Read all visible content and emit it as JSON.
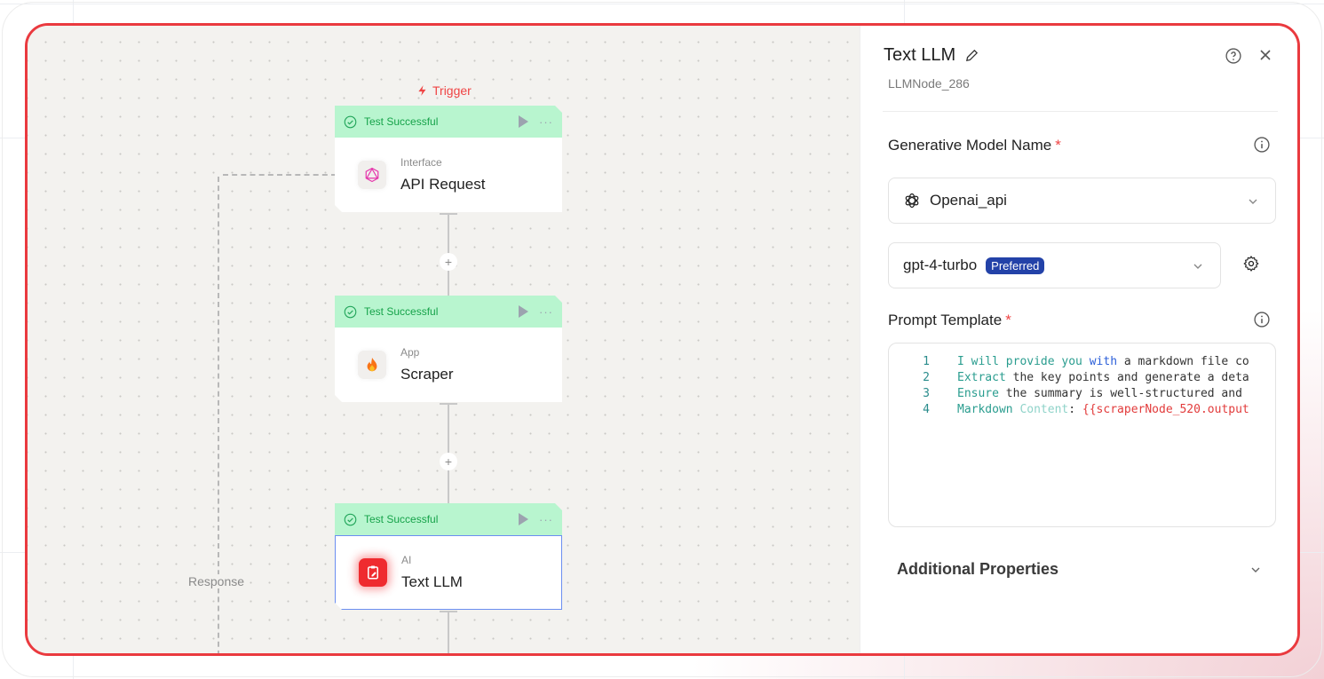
{
  "canvas": {
    "trigger_label": "Trigger",
    "response_label": "Response",
    "nodes": [
      {
        "status": "Test Successful",
        "category": "Interface",
        "name": "API Request",
        "icon": "graphql-icon"
      },
      {
        "status": "Test Successful",
        "category": "App",
        "name": "Scraper",
        "icon": "fire-icon"
      },
      {
        "status": "Test Successful",
        "category": "AI",
        "name": "Text LLM",
        "icon": "clipboard-edit-icon",
        "selected": true
      }
    ]
  },
  "panel": {
    "title": "Text LLM",
    "node_id": "LLMNode_286",
    "model_name_label": "Generative Model Name",
    "required_mark": "*",
    "provider": {
      "value": "Openai_api",
      "icon": "openai-icon"
    },
    "model": {
      "value": "gpt-4-turbo",
      "badge": "Preferred"
    },
    "prompt_label": "Prompt Template",
    "prompt_lines": [
      {
        "num": "1",
        "parts": [
          {
            "t": "I will provide you ",
            "c": "teal"
          },
          {
            "t": "with",
            "c": "kw"
          },
          {
            "t": " a markdown file co",
            "c": "plain"
          }
        ]
      },
      {
        "num": "2",
        "parts": [
          {
            "t": "Extract",
            "c": "teal"
          },
          {
            "t": " the key points and generate a deta",
            "c": "plain"
          }
        ]
      },
      {
        "num": "3",
        "parts": [
          {
            "t": "Ensure",
            "c": "teal"
          },
          {
            "t": " the summary is well-structured and",
            "c": "plain"
          }
        ]
      },
      {
        "num": "4",
        "parts": [
          {
            "t": "Markdown ",
            "c": "teal"
          },
          {
            "t": "Content",
            "c": "mint"
          },
          {
            "t": ": ",
            "c": "plain"
          },
          {
            "t": "{{scraperNode_520.output",
            "c": "red"
          }
        ]
      }
    ],
    "additional_properties_label": "Additional Properties"
  },
  "colors": {
    "frame_border": "#ea3a3f",
    "success_bg": "#b8f5cf",
    "success_text": "#16a34a",
    "badge_bg": "#2342a8",
    "ai_icon_bg": "#ef2b2f"
  }
}
